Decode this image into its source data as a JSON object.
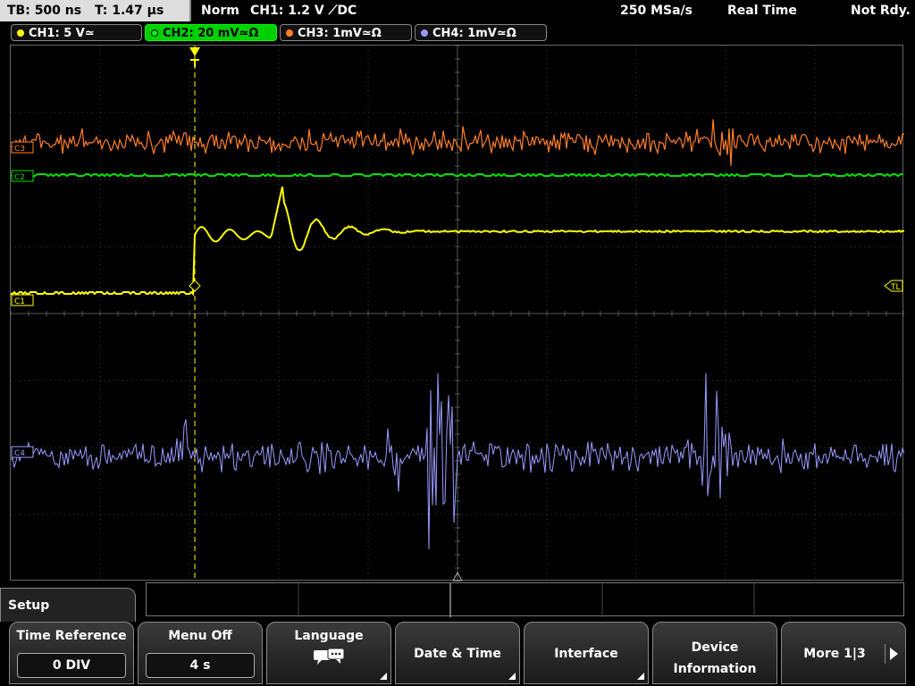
{
  "status": {
    "timebase": "TB: 500 ns",
    "trigger_time": "T: 1.47 µs",
    "mode": "Norm",
    "trigger_info": "CH1: 1.2 V ⟋DC",
    "sample_rate": "250 MSa/s",
    "acq_mode": "Real Time",
    "ready_state": "Not Rdy."
  },
  "channels": [
    {
      "label": "CH1: 5 V≃",
      "color": "#ffff00",
      "active": false
    },
    {
      "label": "CH2: 20 mV≃Ω",
      "color": "#00e000",
      "active": true
    },
    {
      "label": "CH3: 1mV≃Ω",
      "color": "#ff7f27",
      "active": false
    },
    {
      "label": "CH4: 1mV≃Ω",
      "color": "#9a9aff",
      "active": false
    }
  ],
  "markers": {
    "ch3": "C3",
    "ch2": "C2",
    "ch1": "C1",
    "ch4": "C4",
    "trigger_level": "TL"
  },
  "menu": {
    "title": "Setup",
    "time_reference_label": "Time Reference",
    "time_reference_value": "0 DIV",
    "menu_off_label": "Menu Off",
    "menu_off_value": "4 s",
    "language_label": "Language",
    "date_time_label": "Date & Time",
    "interface_label": "Interface",
    "device_info_line1": "Device",
    "device_info_line2": "Information",
    "more_label": "More 1|3"
  },
  "colors": {
    "ch1": "#ffff00",
    "ch2": "#00e000",
    "ch3": "#ff7f27",
    "ch4": "#9a9aff",
    "grid": "#555555"
  }
}
